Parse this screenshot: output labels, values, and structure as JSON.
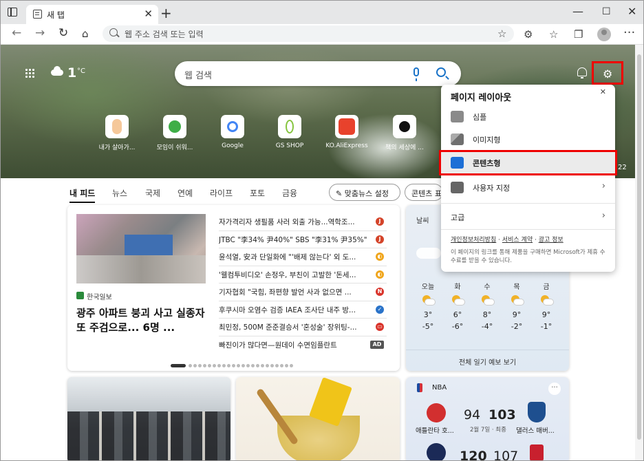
{
  "tab": {
    "title": "새 탭",
    "close": "✕"
  },
  "address": {
    "placeholder": "웹 주소 검색 또는 입력"
  },
  "weather_widget": {
    "temp": "1",
    "unit": "°C"
  },
  "search": {
    "placeholder": "웹 검색"
  },
  "quick_links": [
    {
      "label": "내가 살아가...",
      "color": "#f5c89a"
    },
    {
      "label": "모임이 쉬워...",
      "color": "#3fae47"
    },
    {
      "label": "Google",
      "color": "#4285f4"
    },
    {
      "label": "GS SHOP",
      "color": "#87c540"
    },
    {
      "label": "KO.AliExpress",
      "color": "#e8422c"
    },
    {
      "label": "책의 세상에 ...",
      "color": "#111111"
    }
  ],
  "hero_number": "22",
  "feed_nav": {
    "items": [
      "내 피드",
      "뉴스",
      "국제",
      "연예",
      "라이프",
      "포토",
      "금융"
    ],
    "customize": "맞춤뉴스 설정",
    "content_partial": "콘텐츠 표"
  },
  "news": {
    "source": "한국일보",
    "headline": "광주 아파트 붕괴 사고 실종자 또 주검으로... 6명 ...",
    "list": [
      {
        "text": "자가격리자 생필품 사러 외출 가능...역학조...",
        "badge": "J",
        "badge_color": "#d4442a"
      },
      {
        "text": "JTBC \"李34% 尹40%\" SBS \"李31% 尹35%\" ...",
        "badge": "J",
        "badge_color": "#d4442a"
      },
      {
        "text": "윤석열, 安과 단일화에 \"'배제 않는다' 외 도...",
        "badge": "◐",
        "badge_color": "#f0a61d"
      },
      {
        "text": "'웰컴투비디오' 손정우, 부친이 고발한 '돈세...",
        "badge": "◐",
        "badge_color": "#f0a61d"
      },
      {
        "text": "기자협회 \"국힘, 좌편향 발언 사과 없으면 ...",
        "badge": "N",
        "badge_color": "#d9342b"
      },
      {
        "text": "후쿠시마 오염수 검증 IAEA 조사단 내주 방...",
        "badge": "✓",
        "badge_color": "#2a73c9"
      },
      {
        "text": "최민정, 500M 준준결승서 '혼성술' 장위팅-...",
        "badge": "▭",
        "badge_color": "#d9342b"
      },
      {
        "text": "빠진이가 많다면—원데이 수면임플란트",
        "badge": "AD",
        "badge_color": "#555555"
      }
    ]
  },
  "weather": {
    "header": "날씨",
    "days": [
      {
        "name": "오늘",
        "hi": "3°",
        "lo": "-5°"
      },
      {
        "name": "화",
        "hi": "6°",
        "lo": "-6°"
      },
      {
        "name": "수",
        "hi": "8°",
        "lo": "-4°"
      },
      {
        "name": "목",
        "hi": "9°",
        "lo": "-2°"
      },
      {
        "name": "금",
        "hi": "9°",
        "lo": "-1°"
      }
    ],
    "footer": "전체 일기 예보 보기"
  },
  "nba": {
    "header": "NBA",
    "more": "···",
    "game1": {
      "away_score": "94",
      "home_score": "103",
      "away_team": "애틀란타 호...",
      "home_team": "댈러스 매버...",
      "date": "2월 7일 · 최종"
    },
    "game2": {
      "away_score": "120",
      "home_score": "107"
    }
  },
  "popover": {
    "title": "페이지 레이아웃",
    "close": "✕",
    "items": [
      {
        "label": "심플",
        "icon": "simple-layout-icon",
        "color": "#777777"
      },
      {
        "label": "이미지형",
        "icon": "image-layout-icon",
        "color": "#888888"
      },
      {
        "label": "콘텐츠형",
        "icon": "content-layout-icon",
        "color": "#1d6fd6"
      },
      {
        "label": "사용자 지정",
        "icon": "edit-layout-icon",
        "color": "#666666"
      }
    ],
    "advanced": "고급",
    "links": [
      "개인정보처리방침",
      "서비스 계약",
      "광고 정보"
    ],
    "note": "이 페이지의 링크를 통해 제품을 구매하면 Microsoft가 제휴 수수료를 받을 수 있습니다."
  }
}
